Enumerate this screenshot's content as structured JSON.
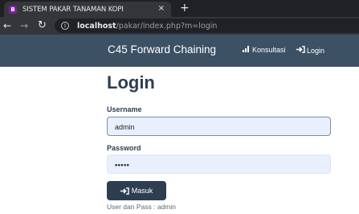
{
  "browser": {
    "tab_title": "SISTEM PAKAR TANAMAN KOPI",
    "favicon_letter": "B",
    "close_glyph": "×",
    "newtab_glyph": "+",
    "url_host": "localhost",
    "url_path": "/pakar/index.php?m=login"
  },
  "navbar": {
    "brand": "C45 Forward Chaining",
    "items": [
      {
        "label": "Konsultasi",
        "icon": "signal-bars-icon"
      },
      {
        "label": "Login",
        "icon": "sign-in-icon"
      }
    ]
  },
  "form": {
    "title": "Login",
    "username_label": "Username",
    "username_value": "admin",
    "password_label": "Password",
    "password_value": "•••••",
    "submit_label": "Masuk",
    "hint": "User dan Pass : admin"
  },
  "colors": {
    "navbar_bg": "#3d5165",
    "primary": "#2c3e50",
    "input_bg": "#e9f0fd"
  }
}
